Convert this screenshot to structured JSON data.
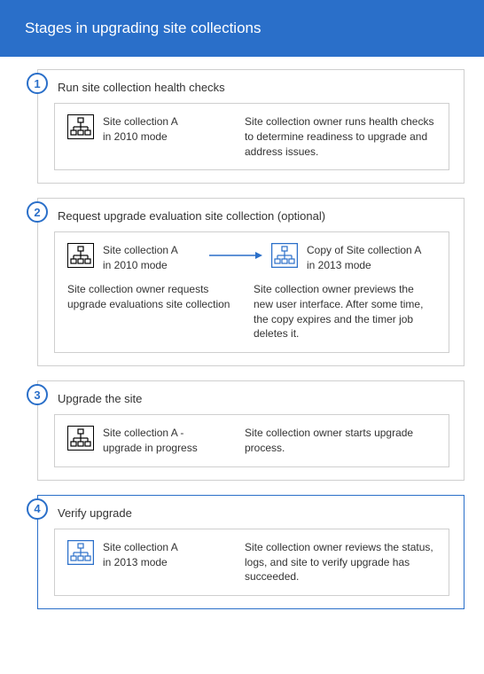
{
  "title": "Stages in upgrading site collections",
  "stages": {
    "s1": {
      "num": "1",
      "title": "Run site collection health checks",
      "site_l1": "Site collection A",
      "site_l2": "in 2010 mode",
      "desc": "Site collection owner runs health checks to determine readiness to upgrade and address issues."
    },
    "s2": {
      "num": "2",
      "title": "Request upgrade evaluation site collection (optional)",
      "siteA_l1": "Site collection A",
      "siteA_l2": "in 2010 mode",
      "siteB_l1": "Copy of Site collection A",
      "siteB_l2": "in 2013 mode",
      "noteA": "Site collection owner requests upgrade evaluations site collection",
      "noteB": "Site collection owner previews the new user interface. After some time, the copy expires and the timer job deletes it."
    },
    "s3": {
      "num": "3",
      "title": "Upgrade the site",
      "site_l1": "Site collection A -",
      "site_l2": "upgrade in progress",
      "desc": "Site collection owner starts upgrade process."
    },
    "s4": {
      "num": "4",
      "title": "Verify upgrade",
      "site_l1": "Site collection A",
      "site_l2": "in 2013 mode",
      "desc": "Site collection owner reviews the status, logs, and site to verify upgrade has succeeded."
    }
  }
}
